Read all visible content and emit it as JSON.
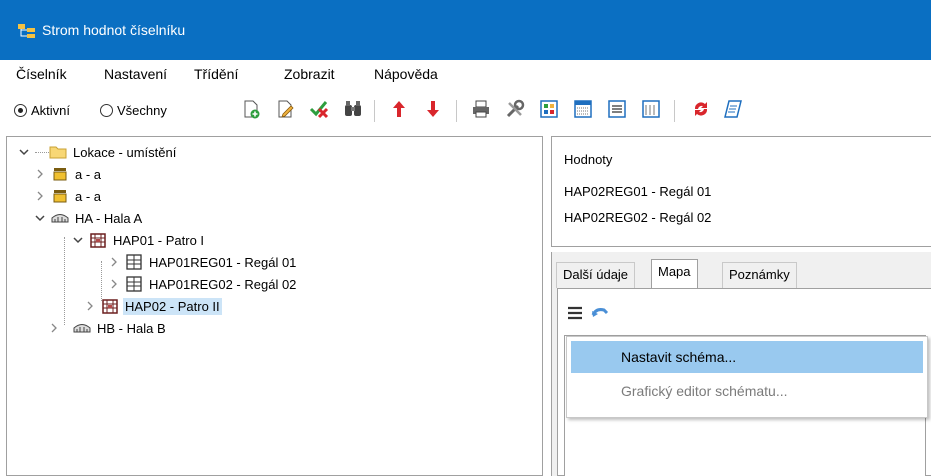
{
  "window": {
    "title": "Strom hodnot číselníku",
    "accent": "#0a6fc2"
  },
  "menu": [
    "Číselník",
    "Nastavení",
    "Třídění",
    "Zobrazit",
    "Nápověda"
  ],
  "toolbar": {
    "radio_active": "Aktivní",
    "radio_all": "Všechny",
    "selected": "Aktivní",
    "buttons": [
      "new-record-icon",
      "edit-record-icon",
      "approve-delete-icon",
      "find-icon",
      "move-up-icon",
      "move-down-icon",
      "print-icon",
      "tools-icon",
      "view-tiles-icon",
      "view-grid-icon",
      "view-list-icon",
      "view-details-icon",
      "refresh-icon",
      "script-icon"
    ]
  },
  "tree": {
    "items": [
      {
        "label": "Lokace - umístění",
        "icon": "folder-icon"
      },
      {
        "label": "a - a",
        "icon": "box-icon"
      },
      {
        "label": "a - a",
        "icon": "box-icon"
      },
      {
        "label": "HA - Hala A",
        "icon": "hall-icon"
      },
      {
        "label": "HAP01 - Patro I",
        "icon": "floor-icon"
      },
      {
        "label": "HAP01REG01 - Regál 01",
        "icon": "shelf-icon"
      },
      {
        "label": "HAP01REG02 - Regál 02",
        "icon": "shelf-icon"
      },
      {
        "label": "HAP02 - Patro II",
        "icon": "floor-icon",
        "selected": true
      },
      {
        "label": "HB - Hala B",
        "icon": "hall-icon"
      }
    ]
  },
  "values": {
    "header": "Hodnoty",
    "items": [
      "HAP02REG01 - Regál 01",
      "HAP02REG02 - Regál 02"
    ]
  },
  "tabs": {
    "items": [
      "Další údaje",
      "Mapa",
      "Poznámky"
    ],
    "active": "Mapa"
  },
  "context_menu": {
    "items": [
      {
        "label": "Nastavit schéma...",
        "highlighted": true,
        "disabled": false
      },
      {
        "label": "Grafický editor schématu...",
        "highlighted": false,
        "disabled": true
      }
    ]
  }
}
